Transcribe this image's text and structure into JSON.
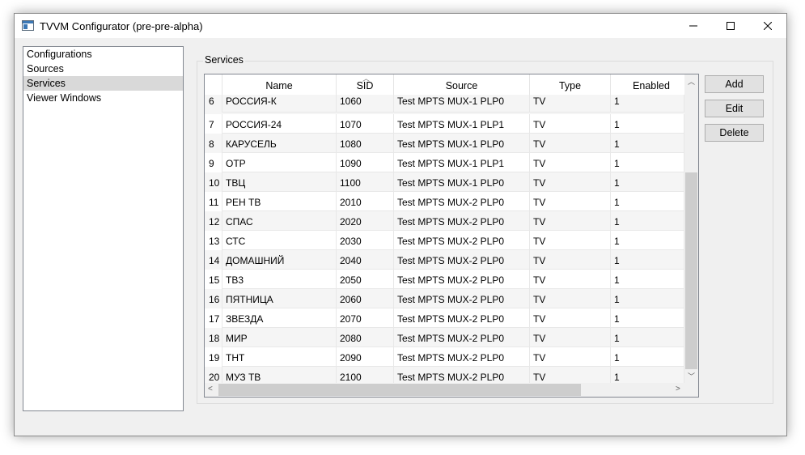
{
  "window": {
    "title": "TVVM Configurator (pre-pre-alpha)"
  },
  "nav": {
    "items": [
      "Configurations",
      "Sources",
      "Services",
      "Viewer Windows"
    ],
    "selected": "Services"
  },
  "services": {
    "group_title": "Services",
    "columns": [
      "Name",
      "SID",
      "Source",
      "Type",
      "Enabled"
    ],
    "sort_column": "SID",
    "rows": [
      {
        "num": "6",
        "name": "РОССИЯ-К",
        "sid": "1060",
        "source": "Test MPTS MUX-1 PLP0",
        "type": "TV",
        "enabled": "1"
      },
      {
        "num": "7",
        "name": "РОССИЯ-24",
        "sid": "1070",
        "source": "Test MPTS MUX-1 PLP1",
        "type": "TV",
        "enabled": "1"
      },
      {
        "num": "8",
        "name": "КАРУСЕЛЬ",
        "sid": "1080",
        "source": "Test MPTS MUX-1 PLP0",
        "type": "TV",
        "enabled": "1"
      },
      {
        "num": "9",
        "name": "ОТР",
        "sid": "1090",
        "source": "Test MPTS MUX-1 PLP1",
        "type": "TV",
        "enabled": "1"
      },
      {
        "num": "10",
        "name": "ТВЦ",
        "sid": "1100",
        "source": "Test MPTS MUX-1 PLP0",
        "type": "TV",
        "enabled": "1"
      },
      {
        "num": "11",
        "name": "РЕН ТВ",
        "sid": "2010",
        "source": "Test MPTS MUX-2 PLP0",
        "type": "TV",
        "enabled": "1"
      },
      {
        "num": "12",
        "name": "СПАС",
        "sid": "2020",
        "source": "Test MPTS MUX-2 PLP0",
        "type": "TV",
        "enabled": "1"
      },
      {
        "num": "13",
        "name": "СТС",
        "sid": "2030",
        "source": "Test MPTS MUX-2 PLP0",
        "type": "TV",
        "enabled": "1"
      },
      {
        "num": "14",
        "name": "ДОМАШНИЙ",
        "sid": "2040",
        "source": "Test MPTS MUX-2 PLP0",
        "type": "TV",
        "enabled": "1"
      },
      {
        "num": "15",
        "name": "ТВ3",
        "sid": "2050",
        "source": "Test MPTS MUX-2 PLP0",
        "type": "TV",
        "enabled": "1"
      },
      {
        "num": "16",
        "name": "ПЯТНИЦА",
        "sid": "2060",
        "source": "Test MPTS MUX-2 PLP0",
        "type": "TV",
        "enabled": "1"
      },
      {
        "num": "17",
        "name": "ЗВЕЗДА",
        "sid": "2070",
        "source": "Test MPTS MUX-2 PLP0",
        "type": "TV",
        "enabled": "1"
      },
      {
        "num": "18",
        "name": "МИР",
        "sid": "2080",
        "source": "Test MPTS MUX-2 PLP0",
        "type": "TV",
        "enabled": "1"
      },
      {
        "num": "19",
        "name": "ТНТ",
        "sid": "2090",
        "source": "Test MPTS MUX-2 PLP0",
        "type": "TV",
        "enabled": "1"
      },
      {
        "num": "20",
        "name": "МУЗ ТВ",
        "sid": "2100",
        "source": "Test MPTS MUX-2 PLP0",
        "type": "TV",
        "enabled": "1"
      }
    ]
  },
  "buttons": {
    "add": "Add",
    "edit": "Edit",
    "delete": "Delete"
  },
  "icons": {
    "app": "app-window-icon",
    "minimize": "minimize-icon",
    "maximize": "maximize-icon",
    "close": "close-icon",
    "sort": "sort-ascending-icon",
    "scroll_up": "scroll-up-arrow-icon",
    "scroll_down": "scroll-down-arrow-icon",
    "scroll_left": "scroll-left-arrow-icon",
    "scroll_right": "scroll-right-arrow-icon"
  }
}
